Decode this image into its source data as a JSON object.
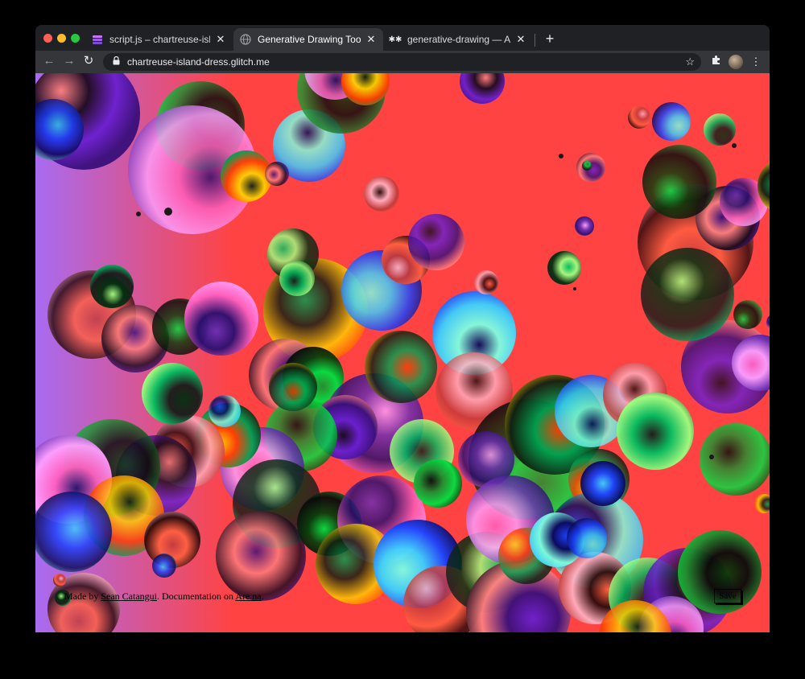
{
  "browser": {
    "tabs": [
      {
        "title": "script.js – chartreuse-island-dress",
        "icon": "glitch-icon",
        "active": false
      },
      {
        "title": "Generative Drawing Tool by Sean Catangui",
        "icon": "globe-icon",
        "active": true
      },
      {
        "title": "generative-drawing — Are.na",
        "icon": "arena-icon",
        "active": false
      }
    ],
    "url": "chartreuse-island-dress.glitch.me"
  },
  "page": {
    "credit_prefix": "Made by ",
    "author": "Sean Catangui",
    "doc_text": ". Documentation on ",
    "doc_link": "Are.na",
    "suffix": ".",
    "save_label": "Save"
  },
  "colors": {
    "background": "#ff4343",
    "gradient_left": "#a86bf2",
    "chrome_bg": "#202124",
    "toolbar_bg": "#35363a"
  }
}
